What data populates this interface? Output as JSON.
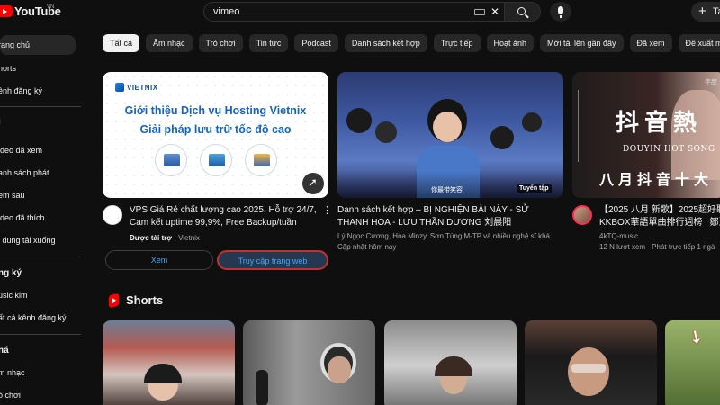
{
  "header": {
    "logo_text": "YouTube",
    "country": "VN",
    "search_value": "vimeo",
    "create_label": "Ta"
  },
  "sidebar": {
    "items": [
      {
        "label": "rang chủ",
        "active": true
      },
      {
        "label": "horts"
      },
      {
        "label": "ênh đăng ký"
      },
      {
        "label": "ideo đã xem"
      },
      {
        "label": "anh sách phát"
      },
      {
        "label": "em sau"
      },
      {
        "label": "ideo đã thích"
      },
      {
        "label": "i dung tải xuống"
      },
      {
        "label": "usic kim"
      },
      {
        "label": "ất cả kênh đăng ký"
      },
      {
        "label": "m nhạc"
      },
      {
        "label": "ò chơi"
      }
    ],
    "sections": [
      "ng ký",
      "há"
    ],
    "first_section": "i"
  },
  "chips": [
    "Tất cả",
    "Âm nhạc",
    "Trò chơi",
    "Tin tức",
    "Podcast",
    "Danh sách kết hợp",
    "Trực tiếp",
    "Hoạt ảnh",
    "Mới tải lên gần đây",
    "Đã xem",
    "Đề xuất mới"
  ],
  "videos": [
    {
      "title": "VPS Giá Rẻ chất lượng cao 2025, Hỗ trợ 24/7, Cam kết uptime 99,9%, Free Backup/tuần",
      "sponsored": "Được tài trợ",
      "channel": "Vietnix",
      "ad_brand": "VIETNIX",
      "ad_line1": "Giới thiệu Dịch vụ Hosting Vietnix",
      "ad_line2": "Giải pháp lưu trữ tốc độ cao",
      "btn_watch": "Xem",
      "btn_visit": "Truy cập trang web"
    },
    {
      "title": "Danh sách kết hợp – BỊ NGHIỆN BÀI NÀY - SỬ THANH HOA - LƯU THẦN DƯƠNG 刘晨阳",
      "channel": "Lý Ngọc Cương, Hòa Minzy, Sơn Tùng M-TP và nhiều nghệ sĩ khá",
      "meta": "Cập nhật hôm nay",
      "thumb_label1": "你最带笑容",
      "thumb_label2": "Tuyển tập"
    },
    {
      "title": "【2025 八月 新歌】2025超好聽 KKBOX華語單曲排行週榜 | 鄒沛",
      "channel": "4kTQ-music",
      "meta": "12 N lượt xem · Phát trực tiếp 1 ngà",
      "thumb_big": "抖音熱",
      "thumb_sub": "DOUYIN HOT SONG",
      "thumb_bottom": "八月抖音十大",
      "thumb_top": "年度"
    }
  ],
  "shorts": {
    "title": "Shorts"
  }
}
